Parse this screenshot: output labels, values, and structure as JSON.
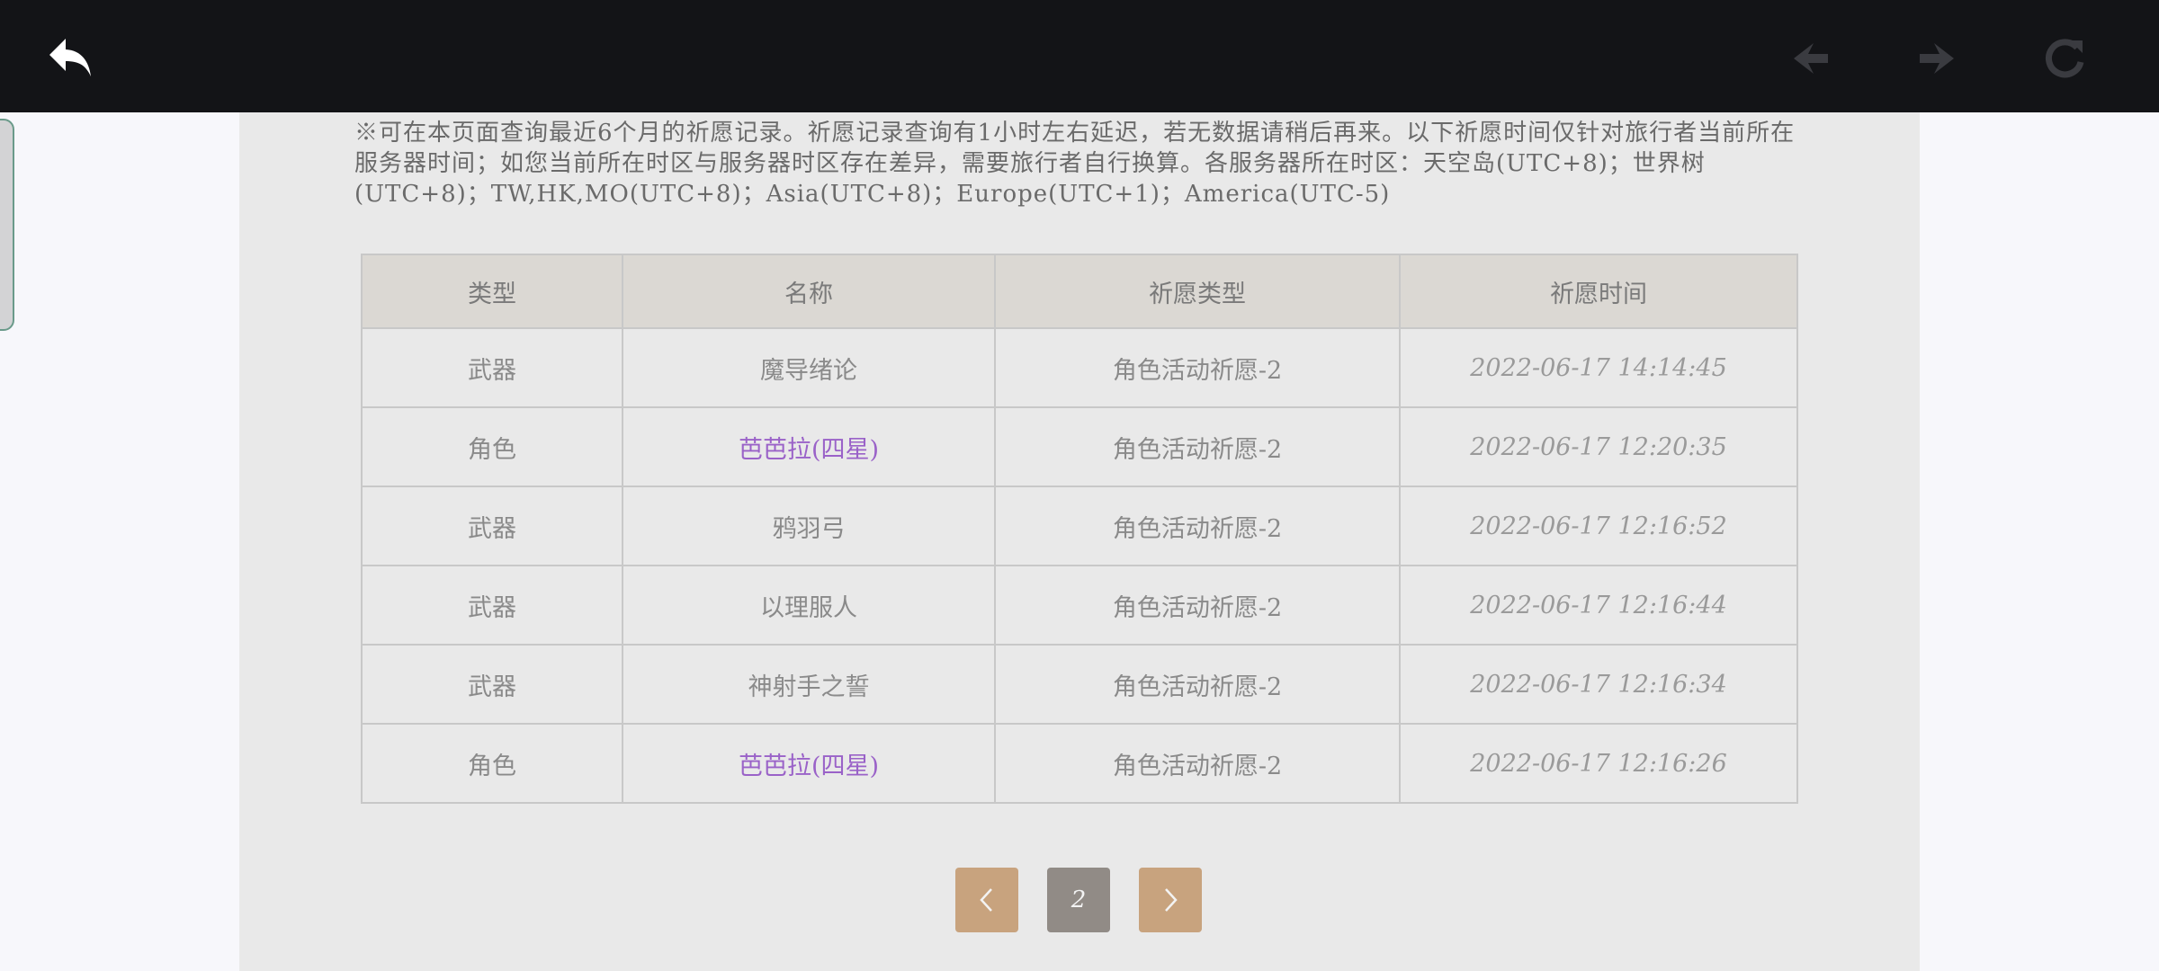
{
  "topbar": {
    "icons": {
      "back": "back-arrow-icon",
      "prev": "nav-prev-icon",
      "next": "nav-next-icon",
      "refresh": "refresh-icon"
    },
    "colors": {
      "background": "#131417",
      "back_icon": "#ffffff",
      "disabled_icon": "#3a3b40"
    }
  },
  "notice": "※可在本页面查询最近6个月的祈愿记录。祈愿记录查询有1小时左右延迟，若无数据请稍后再来。以下祈愿时间仅针对旅行者当前所在服务器时间；如您当前所在时区与服务器时区存在差异，需要旅行者自行换算。各服务器所在时区：天空岛(UTC+8)；世界树(UTC+8)；TW,HK,MO(UTC+8)；Asia(UTC+8)；Europe(UTC+1)；America(UTC-5)",
  "table": {
    "headers": [
      "类型",
      "名称",
      "祈愿类型",
      "祈愿时间"
    ],
    "rows": [
      {
        "type": "武器",
        "name": "魔导绪论",
        "wish_type": "角色活动祈愿-2",
        "time": "2022-06-17 14:14:45",
        "highlight": false
      },
      {
        "type": "角色",
        "name": "芭芭拉(四星)",
        "wish_type": "角色活动祈愿-2",
        "time": "2022-06-17 12:20:35",
        "highlight": true
      },
      {
        "type": "武器",
        "name": "鸦羽弓",
        "wish_type": "角色活动祈愿-2",
        "time": "2022-06-17 12:16:52",
        "highlight": false
      },
      {
        "type": "武器",
        "name": "以理服人",
        "wish_type": "角色活动祈愿-2",
        "time": "2022-06-17 12:16:44",
        "highlight": false
      },
      {
        "type": "武器",
        "name": "神射手之誓",
        "wish_type": "角色活动祈愿-2",
        "time": "2022-06-17 12:16:34",
        "highlight": false
      },
      {
        "type": "角色",
        "name": "芭芭拉(四星)",
        "wish_type": "角色活动祈愿-2",
        "time": "2022-06-17 12:16:26",
        "highlight": true
      }
    ],
    "colors": {
      "header_bg": "#dbd8d3",
      "four_star": "#9a62c8"
    }
  },
  "pagination": {
    "prev_icon": "chevron-left-icon",
    "current": "2",
    "next_icon": "chevron-right-icon",
    "colors": {
      "arrow_bg": "#c8a37e",
      "current_bg": "#918b86"
    }
  }
}
